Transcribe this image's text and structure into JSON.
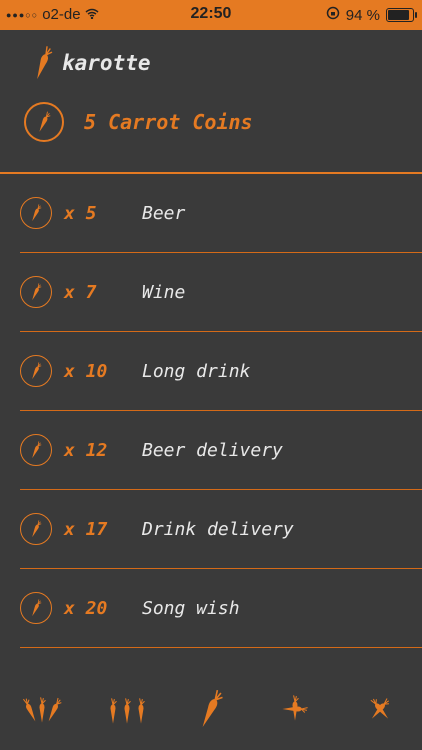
{
  "status": {
    "carrier": "o2-de",
    "time": "22:50",
    "battery": "94 %"
  },
  "app": {
    "name": "karotte"
  },
  "balance": {
    "label": "5 Carrot Coins"
  },
  "items": [
    {
      "qty": "x 5",
      "name": "Beer"
    },
    {
      "qty": "x 7",
      "name": "Wine"
    },
    {
      "qty": "x 10",
      "name": "Long drink"
    },
    {
      "qty": "x 12",
      "name": "Beer delivery"
    },
    {
      "qty": "x 17",
      "name": "Drink delivery"
    },
    {
      "qty": "x 20",
      "name": "Song wish"
    }
  ],
  "tabs": [
    {
      "icon": "carrots-bundle-icon"
    },
    {
      "icon": "three-carrots-icon"
    },
    {
      "icon": "single-carrot-icon"
    },
    {
      "icon": "carrot-plus-icon"
    },
    {
      "icon": "crossed-carrots-icon"
    }
  ],
  "colors": {
    "accent": "#e57a22",
    "background": "#3a3a3a",
    "text": "#e8e8e8"
  }
}
